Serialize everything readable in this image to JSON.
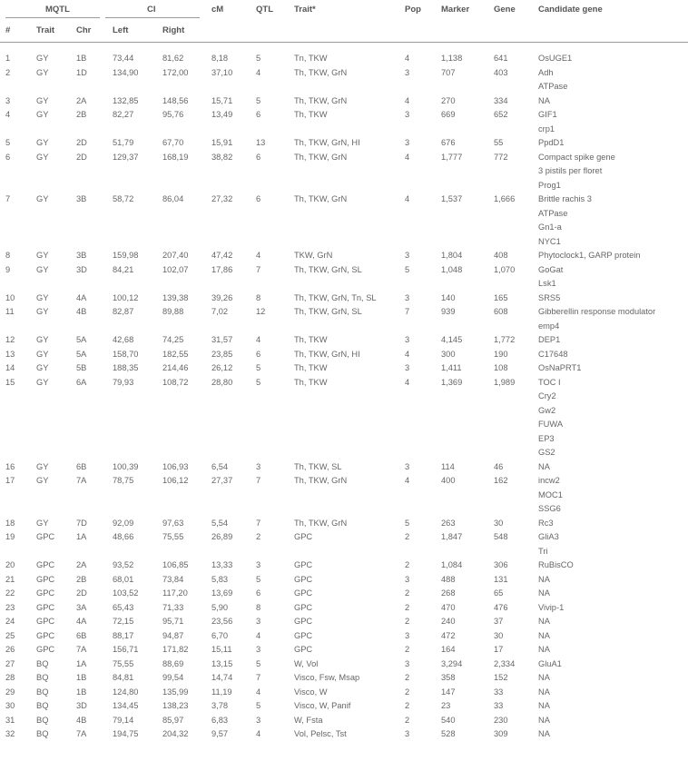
{
  "table": {
    "group_headers": {
      "mqtl": "MQTL",
      "ci": "CI",
      "cm": "cM",
      "qtl": "QTL",
      "trait_star": "Trait*",
      "pop": "Pop",
      "marker": "Marker",
      "gene": "Gene",
      "candidate_gene": "Candidate gene"
    },
    "sub_headers": {
      "num": "#",
      "trait": "Trait",
      "chr": "Chr",
      "left": "Left",
      "right": "Right"
    },
    "rows": [
      {
        "num": "1",
        "trait": "GY",
        "chr": "1B",
        "left": "73,44",
        "right": "81,62",
        "cm": "8,18",
        "qtl": "5",
        "traits": "Tn, TKW",
        "pop": "4",
        "marker": "1,138",
        "gene": "641",
        "candidates": [
          "OsUGE1"
        ]
      },
      {
        "num": "2",
        "trait": "GY",
        "chr": "1D",
        "left": "134,90",
        "right": "172,00",
        "cm": "37,10",
        "qtl": "4",
        "traits": "Th, TKW, GrN",
        "pop": "3",
        "marker": "707",
        "gene": "403",
        "candidates": [
          "Adh",
          "ATPase"
        ]
      },
      {
        "num": "3",
        "trait": "GY",
        "chr": "2A",
        "left": "132,85",
        "right": "148,56",
        "cm": "15,71",
        "qtl": "5",
        "traits": "Th, TKW, GrN",
        "pop": "4",
        "marker": "270",
        "gene": "334",
        "candidates": [
          "NA"
        ]
      },
      {
        "num": "4",
        "trait": "GY",
        "chr": "2B",
        "left": "82,27",
        "right": "95,76",
        "cm": "13,49",
        "qtl": "6",
        "traits": "Th, TKW",
        "pop": "3",
        "marker": "669",
        "gene": "652",
        "candidates": [
          "GIF1",
          "crp1"
        ]
      },
      {
        "num": "5",
        "trait": "GY",
        "chr": "2D",
        "left": "51,79",
        "right": "67,70",
        "cm": "15,91",
        "qtl": "13",
        "traits": "Th, TKW, GrN, HI",
        "pop": "3",
        "marker": "676",
        "gene": "55",
        "candidates": [
          "PpdD1"
        ]
      },
      {
        "num": "6",
        "trait": "GY",
        "chr": "2D",
        "left": "129,37",
        "right": "168,19",
        "cm": "38,82",
        "qtl": "6",
        "traits": "Th, TKW, GrN",
        "pop": "4",
        "marker": "1,777",
        "gene": "772",
        "candidates": [
          "Compact spike gene",
          "3 pistils per floret",
          "Prog1"
        ]
      },
      {
        "num": "7",
        "trait": "GY",
        "chr": "3B",
        "left": "58,72",
        "right": "86,04",
        "cm": "27,32",
        "qtl": "6",
        "traits": "Th, TKW, GrN",
        "pop": "4",
        "marker": "1,537",
        "gene": "1,666",
        "candidates": [
          "Brittle rachis 3",
          "ATPase",
          "Gn1-a",
          "NYC1"
        ]
      },
      {
        "num": "8",
        "trait": "GY",
        "chr": "3B",
        "left": "159,98",
        "right": "207,40",
        "cm": "47,42",
        "qtl": "4",
        "traits": "TKW, GrN",
        "pop": "3",
        "marker": "1,804",
        "gene": "408",
        "candidates": [
          "Phytoclock1, GARP protein"
        ]
      },
      {
        "num": "9",
        "trait": "GY",
        "chr": "3D",
        "left": "84,21",
        "right": "102,07",
        "cm": "17,86",
        "qtl": "7",
        "traits": "Th, TKW, GrN, SL",
        "pop": "5",
        "marker": "1,048",
        "gene": "1,070",
        "candidates": [
          "GoGat",
          "Lsk1"
        ]
      },
      {
        "num": "10",
        "trait": "GY",
        "chr": "4A",
        "left": "100,12",
        "right": "139,38",
        "cm": "39,26",
        "qtl": "8",
        "traits": "Th, TKW, GrN, Tn, SL",
        "pop": "3",
        "marker": "140",
        "gene": "165",
        "candidates": [
          "SRS5"
        ]
      },
      {
        "num": "11",
        "trait": "GY",
        "chr": "4B",
        "left": "82,87",
        "right": "89,88",
        "cm": "7,02",
        "qtl": "12",
        "traits": "Th, TKW, GrN, SL",
        "pop": "7",
        "marker": "939",
        "gene": "608",
        "candidates": [
          "Gibberellin response modulator",
          "emp4"
        ]
      },
      {
        "num": "12",
        "trait": "GY",
        "chr": "5A",
        "left": "42,68",
        "right": "74,25",
        "cm": "31,57",
        "qtl": "4",
        "traits": "Th, TKW",
        "pop": "3",
        "marker": "4,145",
        "gene": "1,772",
        "candidates": [
          "DEP1"
        ]
      },
      {
        "num": "13",
        "trait": "GY",
        "chr": "5A",
        "left": "158,70",
        "right": "182,55",
        "cm": "23,85",
        "qtl": "6",
        "traits": "Th, TKW, GrN, HI",
        "pop": "4",
        "marker": "300",
        "gene": "190",
        "candidates": [
          "C17648"
        ]
      },
      {
        "num": "14",
        "trait": "GY",
        "chr": "5B",
        "left": "188,35",
        "right": "214,46",
        "cm": "26,12",
        "qtl": "5",
        "traits": "Th, TKW",
        "pop": "3",
        "marker": "1,411",
        "gene": "108",
        "candidates": [
          "OsNaPRT1"
        ]
      },
      {
        "num": "15",
        "trait": "GY",
        "chr": "6A",
        "left": "79,93",
        "right": "108,72",
        "cm": "28,80",
        "qtl": "5",
        "traits": "Th, TKW",
        "pop": "4",
        "marker": "1,369",
        "gene": "1,989",
        "candidates": [
          "TOC I",
          "Cry2",
          "Gw2",
          "FUWA",
          "EP3",
          "GS2"
        ]
      },
      {
        "num": "16",
        "trait": "GY",
        "chr": "6B",
        "left": "100,39",
        "right": "106,93",
        "cm": "6,54",
        "qtl": "3",
        "traits": "Th, TKW, SL",
        "pop": "3",
        "marker": "114",
        "gene": "46",
        "candidates": [
          "NA"
        ]
      },
      {
        "num": "17",
        "trait": "GY",
        "chr": "7A",
        "left": "78,75",
        "right": "106,12",
        "cm": "27,37",
        "qtl": "7",
        "traits": "Th, TKW, GrN",
        "pop": "4",
        "marker": "400",
        "gene": "162",
        "candidates": [
          "incw2",
          "MOC1",
          "SSG6"
        ]
      },
      {
        "num": "18",
        "trait": "GY",
        "chr": "7D",
        "left": "92,09",
        "right": "97,63",
        "cm": "5,54",
        "qtl": "7",
        "traits": "Th, TKW, GrN",
        "pop": "5",
        "marker": "263",
        "gene": "30",
        "candidates": [
          "Rc3"
        ]
      },
      {
        "num": "19",
        "trait": "GPC",
        "chr": "1A",
        "left": "48,66",
        "right": "75,55",
        "cm": "26,89",
        "qtl": "2",
        "traits": "GPC",
        "pop": "2",
        "marker": "1,847",
        "gene": "548",
        "candidates": [
          "GliA3",
          "Tri"
        ]
      },
      {
        "num": "20",
        "trait": "GPC",
        "chr": "2A",
        "left": "93,52",
        "right": "106,85",
        "cm": "13,33",
        "qtl": "3",
        "traits": "GPC",
        "pop": "2",
        "marker": "1,084",
        "gene": "306",
        "candidates": [
          "RuBisCO"
        ]
      },
      {
        "num": "21",
        "trait": "GPC",
        "chr": "2B",
        "left": "68,01",
        "right": "73,84",
        "cm": "5,83",
        "qtl": "5",
        "traits": "GPC",
        "pop": "3",
        "marker": "488",
        "gene": "131",
        "candidates": [
          "NA"
        ]
      },
      {
        "num": "22",
        "trait": "GPC",
        "chr": "2D",
        "left": "103,52",
        "right": "117,20",
        "cm": "13,69",
        "qtl": "6",
        "traits": "GPC",
        "pop": "2",
        "marker": "268",
        "gene": "65",
        "candidates": [
          "NA"
        ]
      },
      {
        "num": "23",
        "trait": "GPC",
        "chr": "3A",
        "left": "65,43",
        "right": "71,33",
        "cm": "5,90",
        "qtl": "8",
        "traits": "GPC",
        "pop": "2",
        "marker": "470",
        "gene": "476",
        "candidates": [
          "Vivip-1"
        ]
      },
      {
        "num": "24",
        "trait": "GPC",
        "chr": "4A",
        "left": "72,15",
        "right": "95,71",
        "cm": "23,56",
        "qtl": "3",
        "traits": "GPC",
        "pop": "2",
        "marker": "240",
        "gene": "37",
        "candidates": [
          "NA"
        ]
      },
      {
        "num": "25",
        "trait": "GPC",
        "chr": "6B",
        "left": "88,17",
        "right": "94,87",
        "cm": "6,70",
        "qtl": "4",
        "traits": "GPC",
        "pop": "3",
        "marker": "472",
        "gene": "30",
        "candidates": [
          "NA"
        ]
      },
      {
        "num": "26",
        "trait": "GPC",
        "chr": "7A",
        "left": "156,71",
        "right": "171,82",
        "cm": "15,11",
        "qtl": "3",
        "traits": "GPC",
        "pop": "2",
        "marker": "164",
        "gene": "17",
        "candidates": [
          "NA"
        ]
      },
      {
        "num": "27",
        "trait": "BQ",
        "chr": "1A",
        "left": "75,55",
        "right": "88,69",
        "cm": "13,15",
        "qtl": "5",
        "traits": "W, Vol",
        "pop": "3",
        "marker": "3,294",
        "gene": "2,334",
        "candidates": [
          "GluA1"
        ]
      },
      {
        "num": "28",
        "trait": "BQ",
        "chr": "1B",
        "left": "84,81",
        "right": "99,54",
        "cm": "14,74",
        "qtl": "7",
        "traits": "Visco, Fsw, Msap",
        "pop": "2",
        "marker": "358",
        "gene": "152",
        "candidates": [
          "NA"
        ]
      },
      {
        "num": "29",
        "trait": "BQ",
        "chr": "1B",
        "left": "124,80",
        "right": "135,99",
        "cm": "11,19",
        "qtl": "4",
        "traits": "Visco, W",
        "pop": "2",
        "marker": "147",
        "gene": "33",
        "candidates": [
          "NA"
        ]
      },
      {
        "num": "30",
        "trait": "BQ",
        "chr": "3D",
        "left": "134,45",
        "right": "138,23",
        "cm": "3,78",
        "qtl": "5",
        "traits": "Visco, W, Panif",
        "pop": "2",
        "marker": "23",
        "gene": "33",
        "candidates": [
          "NA"
        ]
      },
      {
        "num": "31",
        "trait": "BQ",
        "chr": "4B",
        "left": "79,14",
        "right": "85,97",
        "cm": "6,83",
        "qtl": "3",
        "traits": "W, Fsta",
        "pop": "2",
        "marker": "540",
        "gene": "230",
        "candidates": [
          "NA"
        ]
      },
      {
        "num": "32",
        "trait": "BQ",
        "chr": "7A",
        "left": "194,75",
        "right": "204,32",
        "cm": "9,57",
        "qtl": "4",
        "traits": "Vol, Pelsc, Tst",
        "pop": "3",
        "marker": "528",
        "gene": "309",
        "candidates": [
          "NA"
        ]
      }
    ]
  }
}
